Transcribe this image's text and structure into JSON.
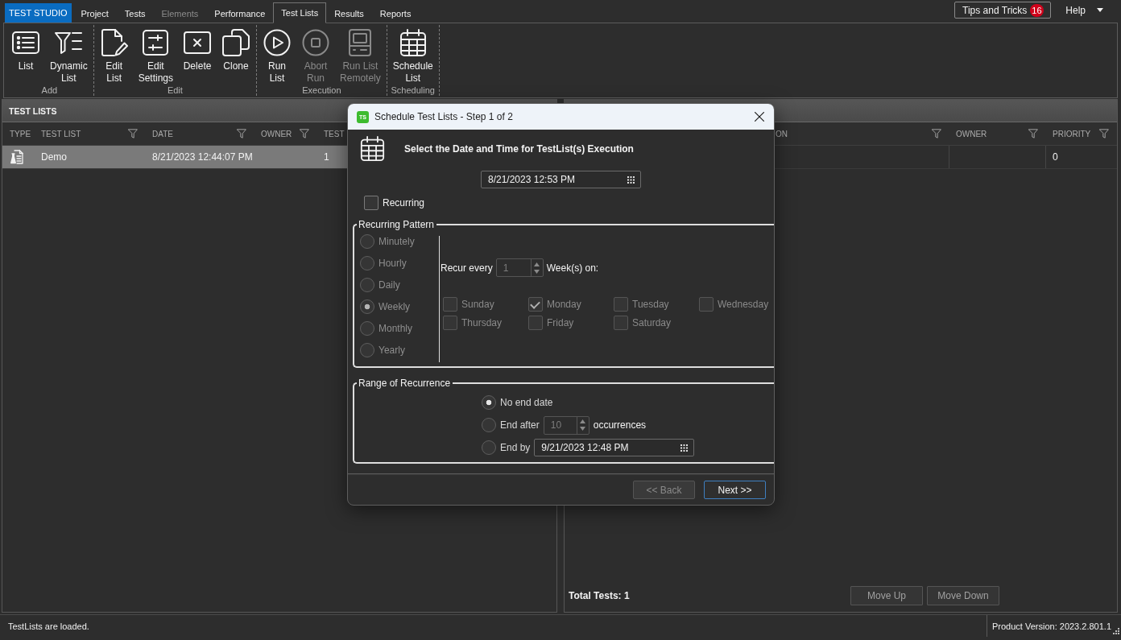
{
  "menu_bar": {
    "app_menu": "TEST STUDIO",
    "tabs": [
      {
        "label": "Project",
        "selected": false,
        "disabled": false
      },
      {
        "label": "Tests",
        "selected": false,
        "disabled": false
      },
      {
        "label": "Elements",
        "selected": false,
        "disabled": true
      },
      {
        "label": "Performance",
        "selected": false,
        "disabled": false
      },
      {
        "label": "Test Lists",
        "selected": true,
        "disabled": false
      },
      {
        "label": "Results",
        "selected": false,
        "disabled": false
      },
      {
        "label": "Reports",
        "selected": false,
        "disabled": false
      }
    ],
    "tips": {
      "label": "Tips and Tricks",
      "badge": "16"
    },
    "help": "Help"
  },
  "ribbon": {
    "groups": [
      {
        "label": "Add",
        "buttons": [
          {
            "label": "List",
            "disabled": false
          },
          {
            "label": "Dynamic\nList",
            "disabled": false
          }
        ]
      },
      {
        "label": "Edit",
        "buttons": [
          {
            "label": "Edit\nList",
            "disabled": false
          },
          {
            "label": "Edit\nSettings",
            "disabled": false
          },
          {
            "label": "Delete",
            "disabled": false
          },
          {
            "label": "Clone",
            "disabled": false
          }
        ]
      },
      {
        "label": "Execution",
        "buttons": [
          {
            "label": "Run\nList",
            "disabled": false
          },
          {
            "label": "Abort\nRun",
            "disabled": true
          },
          {
            "label": "Run List\nRemotely",
            "disabled": true
          }
        ]
      },
      {
        "label": "Scheduling",
        "buttons": [
          {
            "label": "Schedule\nList",
            "disabled": false
          }
        ]
      }
    ]
  },
  "test_lists_panel": {
    "title": "TEST LISTS",
    "columns": [
      {
        "label": "TYPE"
      },
      {
        "label": "TEST LIST",
        "filter": true
      },
      {
        "label": "DATE",
        "filter": true
      },
      {
        "label": "OWNER",
        "filter": true
      },
      {
        "label": "TEST"
      }
    ],
    "rows": [
      {
        "selected": true,
        "name": "Demo",
        "date": "8/21/2023 12:44:07 PM",
        "tests": "1"
      }
    ]
  },
  "tests_panel": {
    "columns": [
      {
        "label": "ON",
        "filter": true
      },
      {
        "label": "OWNER",
        "filter": true
      },
      {
        "label": "PRIORITY",
        "filter": true
      }
    ],
    "rows": [
      {
        "selected": false,
        "priority": "0"
      }
    ],
    "total": "Total Tests: 1",
    "buttons": [
      {
        "label": "Move Up",
        "disabled": true
      },
      {
        "label": "Move Down",
        "disabled": true
      }
    ]
  },
  "dialog": {
    "logo": "TS",
    "title": "Schedule Test Lists - Step 1 of 2",
    "heading": "Select the Date and Time for TestList(s) Execution",
    "start_date": "8/21/2023 12:53 PM",
    "recurring": {
      "label": "Recurring",
      "checked": false
    },
    "recurring_pattern": {
      "legend": "Recurring Pattern",
      "disabled": true,
      "frequencies": [
        {
          "label": "Minutely",
          "selected": false
        },
        {
          "label": "Hourly",
          "selected": false
        },
        {
          "label": "Daily",
          "selected": false
        },
        {
          "label": "Weekly",
          "selected": true
        },
        {
          "label": "Monthly",
          "selected": false
        },
        {
          "label": "Yearly",
          "selected": false
        }
      ],
      "recur_every": "Recur every",
      "interval": "1",
      "unit": "Week(s) on:",
      "days": [
        {
          "label": "Sunday",
          "checked": false
        },
        {
          "label": "Monday",
          "checked": true
        },
        {
          "label": "Tuesday",
          "checked": false
        },
        {
          "label": "Wednesday",
          "checked": false
        },
        {
          "label": "Thursday",
          "checked": false
        },
        {
          "label": "Friday",
          "checked": false
        },
        {
          "label": "Saturday",
          "checked": false
        }
      ]
    },
    "range": {
      "legend": "Range of Recurrence",
      "options": [
        {
          "kind": "none",
          "label": "No end date",
          "selected": true
        },
        {
          "kind": "count",
          "label": "End after",
          "value": "10",
          "suffix": "occurrences",
          "selected": false
        },
        {
          "kind": "date",
          "label": "End by",
          "value": "9/21/2023 12:48 PM",
          "selected": false
        }
      ]
    },
    "buttons": [
      {
        "label": "<< Back",
        "disabled": true,
        "default": false
      },
      {
        "label": "Next >>",
        "disabled": false,
        "default": true
      }
    ]
  },
  "status_bar": {
    "message": "TestLists are loaded.",
    "version": "Product Version: 2023.2.801.1"
  }
}
